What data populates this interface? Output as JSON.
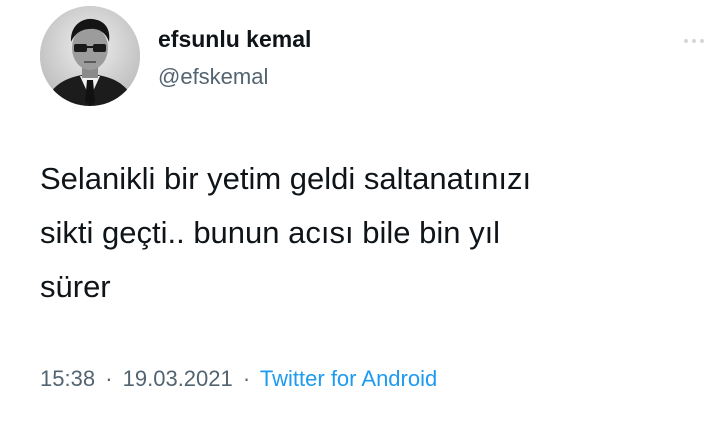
{
  "author": {
    "display_name": "efsunlu kemal",
    "handle": "@efskemal"
  },
  "tweet": {
    "text_lines": [
      "Selanikli bir yetim geldi saltanatınızı",
      "sikti geçti.. bunun acısı bile bin yıl",
      "sürer"
    ],
    "time": "15:38",
    "date": "19.03.2021",
    "separator": "·",
    "source": "Twitter for Android"
  },
  "icons": {
    "avatar": "profile-photo",
    "more": "more-options-icon"
  },
  "colors": {
    "text": "#0f1419",
    "secondary": "#536471",
    "link": "#1d9bf0",
    "background": "#ffffff"
  }
}
